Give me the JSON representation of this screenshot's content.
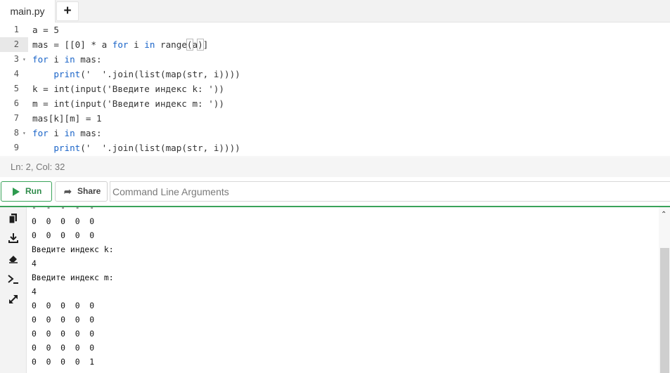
{
  "tabs": {
    "file_name": "main.py",
    "add_label": "+"
  },
  "editor": {
    "active_line": 2,
    "lines": [
      {
        "num": "1",
        "text": "a = 5"
      },
      {
        "num": "2",
        "text": "mas = [[0] * a for i in range(a)]"
      },
      {
        "num": "3",
        "text": "for i in mas:"
      },
      {
        "num": "4",
        "text": "    print('  '.join(list(map(str, i))))"
      },
      {
        "num": "5",
        "text": "k = int(input('Введите индекс k: '))"
      },
      {
        "num": "6",
        "text": "m = int(input('Введите индекс m: '))"
      },
      {
        "num": "7",
        "text": "mas[k][m] = 1"
      },
      {
        "num": "8",
        "text": "for i in mas:"
      },
      {
        "num": "9",
        "text": "    print('  '.join(list(map(str, i))))"
      }
    ],
    "status": "Ln: 2,  Col: 32"
  },
  "toolbar": {
    "run_label": "Run",
    "share_label": "Share",
    "args_placeholder": "Command Line Arguments"
  },
  "output": {
    "lines": [
      "-  -  -  -  -",
      "0  0  0  0  0",
      "0  0  0  0  0",
      "Введите индекс k:",
      "4",
      "Введите индекс m:",
      "4",
      "0  0  0  0  0",
      "0  0  0  0  0",
      "0  0  0  0  0",
      "0  0  0  0  0",
      "0  0  0  0  1"
    ]
  },
  "icons": {
    "copy": "copy-icon",
    "download": "download-icon",
    "erase": "eraser-icon",
    "terminal": "terminal-icon",
    "expand": "expand-icon"
  },
  "colors": {
    "accent_green": "#3aa35a",
    "keyword_blue": "#1a64c8"
  }
}
